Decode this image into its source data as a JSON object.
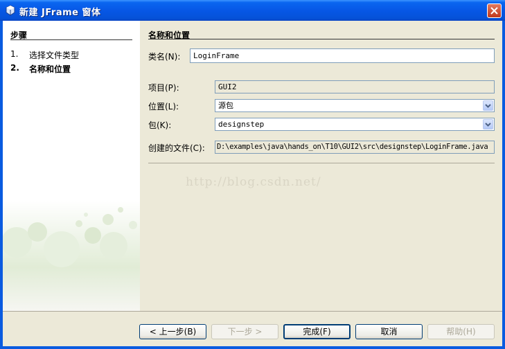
{
  "window": {
    "title": "新建 JFrame 窗体"
  },
  "sidebar": {
    "title": "步骤",
    "steps": [
      {
        "num": "1.",
        "label": "选择文件类型"
      },
      {
        "num": "2.",
        "label": "名称和位置"
      }
    ]
  },
  "main": {
    "title": "名称和位置",
    "class_name": {
      "label": "类名(N):",
      "value": "LoginFrame"
    },
    "project": {
      "label": "项目(P):",
      "value": "GUI2"
    },
    "location": {
      "label": "位置(L):",
      "value": "源包"
    },
    "package": {
      "label": "包(K):",
      "value": "designstep"
    },
    "created_file": {
      "label": "创建的文件(C):",
      "value": "D:\\examples\\java\\hands_on\\T10\\GUI2\\src\\designstep\\LoginFrame.java"
    }
  },
  "watermark": "http://blog.csdn.net/",
  "buttons": {
    "back": "< 上一步(B)",
    "next": "下一步 >",
    "finish": "完成(F)",
    "cancel": "取消",
    "help": "帮助(H)"
  }
}
